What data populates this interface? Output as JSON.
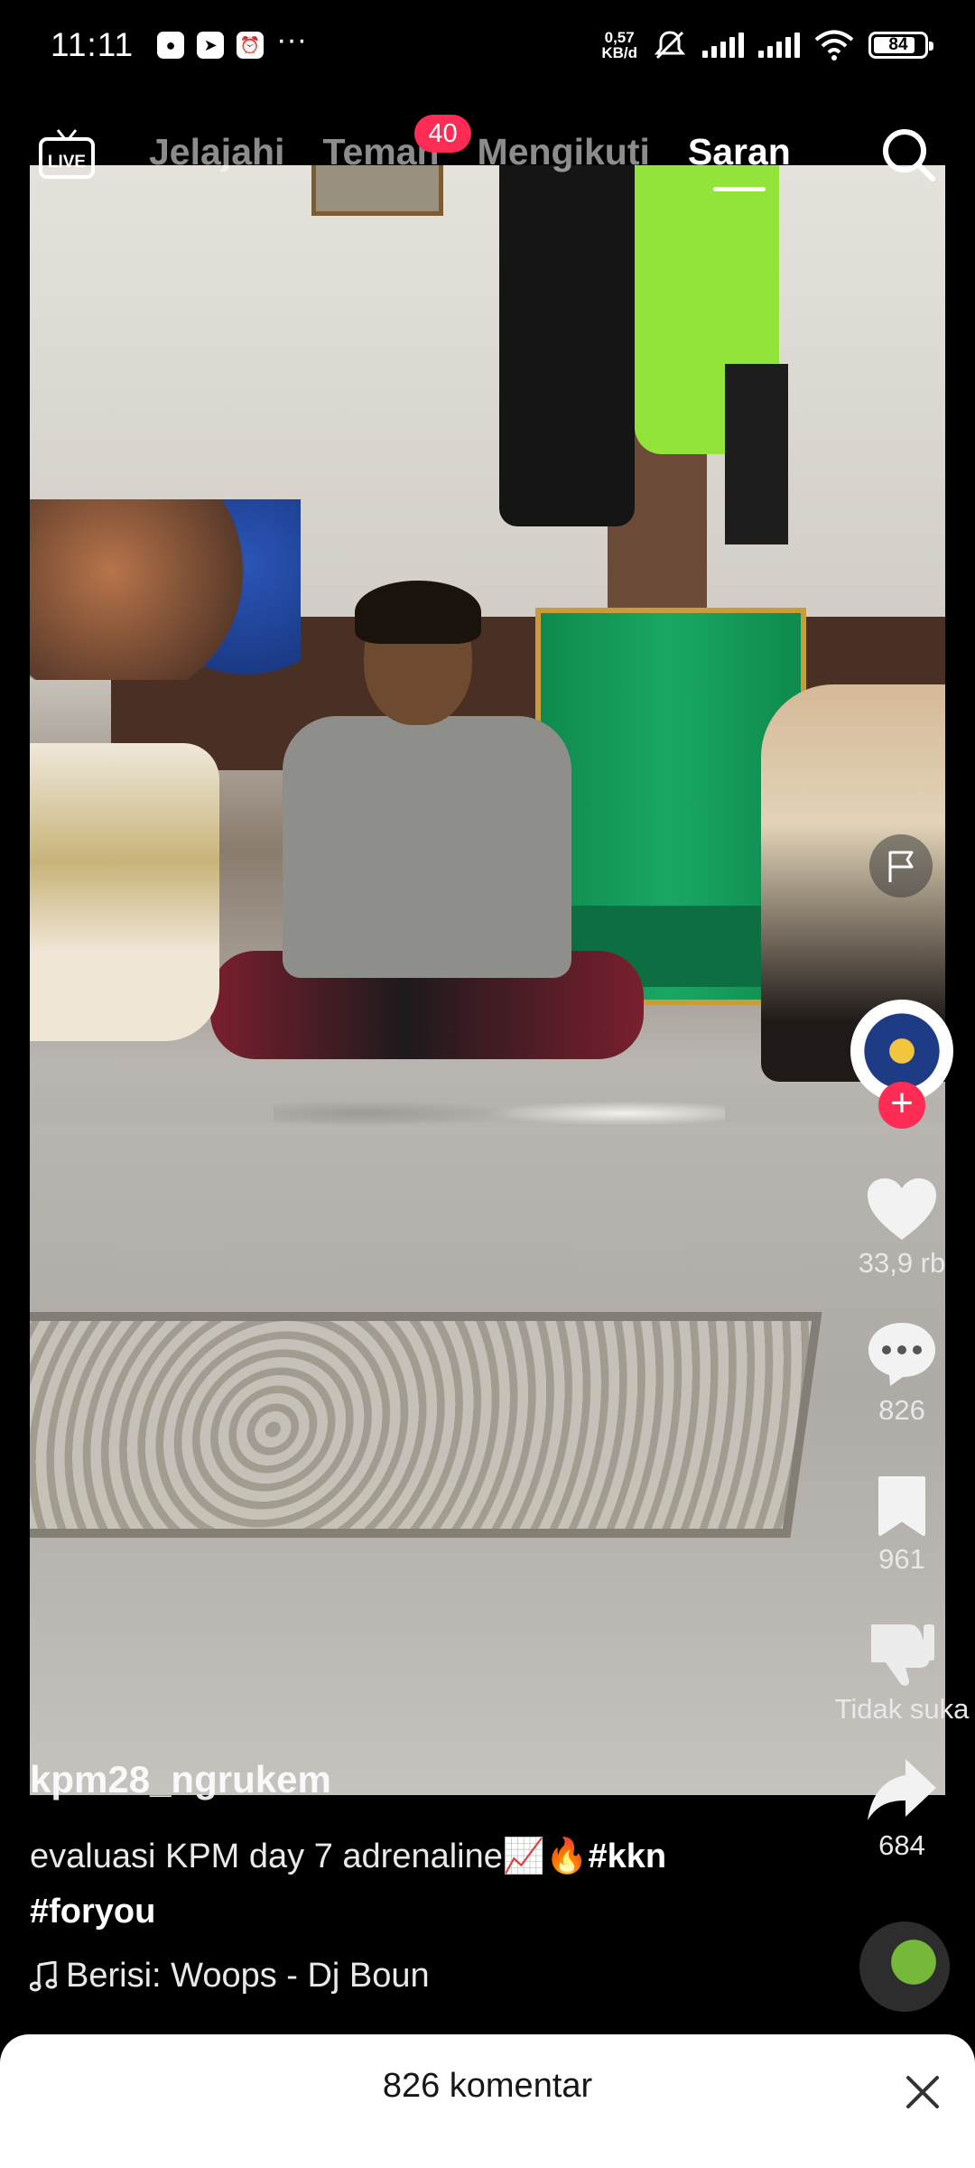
{
  "status_bar": {
    "time": "11:11",
    "net_speed_value": "0,57",
    "net_speed_unit": "KB/d",
    "battery": "84",
    "battery_level": 0.84
  },
  "top_nav": {
    "live_label": "LIVE",
    "tabs": [
      {
        "label": "Jelajahi",
        "active": false
      },
      {
        "label": "Teman",
        "active": false
      },
      {
        "label": "Mengikuti",
        "active": false
      },
      {
        "label": "Saran",
        "active": true
      }
    ],
    "friends_badge": "40"
  },
  "actions": {
    "likes": "33,9 rb",
    "comments": "826",
    "saves": "961",
    "dislike_label": "Tidak suka",
    "shares": "684"
  },
  "post": {
    "username": "kpm28_ngrukem",
    "caption_text": "evaluasi KPM day 7 adrenaline📈🔥",
    "hashtag_1": "#kkn",
    "hashtag_2": "#foryou",
    "sound": "Berisi: Woops - Dj Boun"
  },
  "comments_sheet": {
    "title": "826 komentar"
  },
  "colors": {
    "accent": "#fe2c55",
    "background": "#000000",
    "sheet": "#ffffff"
  },
  "icons": {
    "live": "live-tv-icon",
    "search": "search-icon",
    "report": "flag-icon",
    "like": "heart-icon",
    "comment": "comment-bubble-icon",
    "save": "bookmark-icon",
    "dislike": "thumbs-down-icon",
    "share": "share-arrow-icon",
    "close": "close-icon",
    "music": "music-note-icon"
  }
}
